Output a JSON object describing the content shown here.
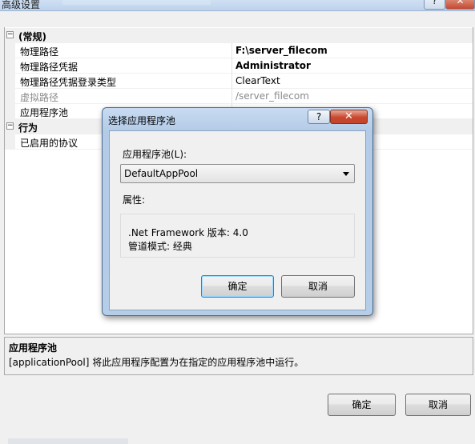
{
  "window": {
    "title": "高级设置"
  },
  "property_grid": {
    "categories": [
      {
        "expander": "⊟",
        "name": "(常规)",
        "properties": [
          {
            "name": "物理路径",
            "value": "F:\\server_filecom",
            "bold": true
          },
          {
            "name": "物理路径凭据",
            "value": "Administrator",
            "bold": true
          },
          {
            "name": "物理路径凭据登录类型",
            "value": "ClearText"
          },
          {
            "name": "虚拟路径",
            "value": "/server_filecom",
            "grayed": true
          },
          {
            "name": "应用程序池",
            "value": ""
          }
        ]
      },
      {
        "expander": "⊟",
        "name": "行为",
        "properties": [
          {
            "name": "已启用的协议",
            "value": ""
          }
        ]
      }
    ]
  },
  "description": {
    "title": "应用程序池",
    "text": "[applicationPool] 将此应用程序配置为在指定的应用程序池中运行。"
  },
  "buttons": {
    "ok": "确定",
    "cancel": "取消"
  },
  "dialog": {
    "title": "选择应用程序池",
    "help_glyph": "?",
    "close_glyph": "✕",
    "pool_label": "应用程序池(L):",
    "pool_selected": "DefaultAppPool",
    "properties_label": "属性:",
    "framework_line": ".Net Framework 版本: 4.0",
    "pipeline_line": "管道模式: 经典",
    "ok": "确定",
    "cancel": "取消"
  },
  "icons": {
    "expander": "minus-box-icon",
    "dropdown": "chevron-down-icon",
    "help": "question-icon",
    "close": "close-icon"
  }
}
